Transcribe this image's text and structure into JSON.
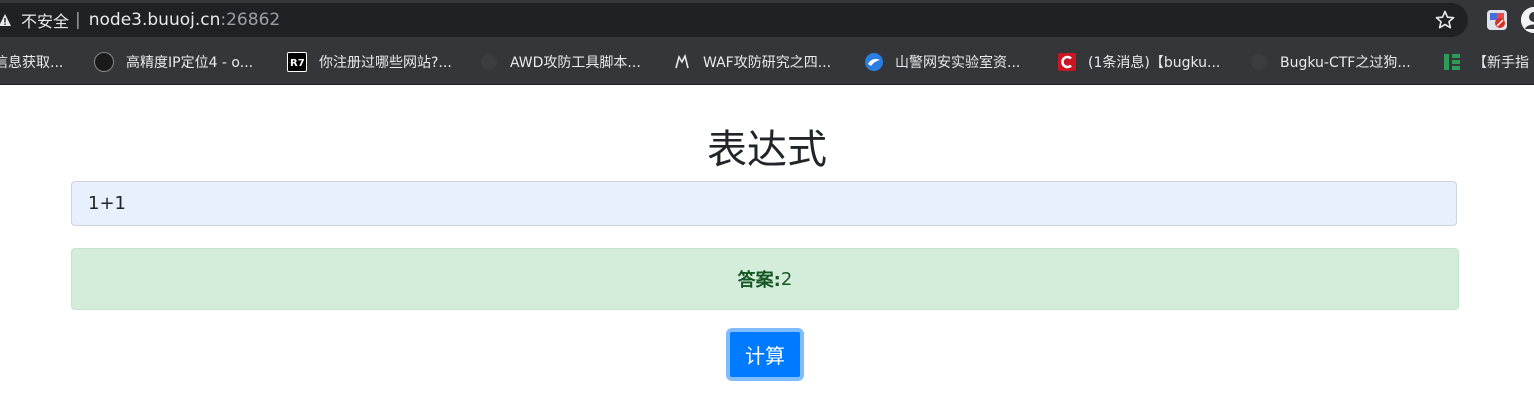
{
  "browser": {
    "security_label": "不安全",
    "separator": "|",
    "url_host": "node3.buuoj.cn",
    "url_port": ":26862",
    "bookmarks": [
      {
        "label": "信息获取...",
        "icon": "none"
      },
      {
        "label": "高精度IP定位4 - o...",
        "icon": "avatar-icon"
      },
      {
        "label": "你注册过哪些网站?...",
        "icon": "r7-icon"
      },
      {
        "label": "AWD攻防工具脚本...",
        "icon": "github-icon"
      },
      {
        "label": "WAF攻防研究之四...",
        "icon": "wolf-icon"
      },
      {
        "label": "山警网安实验室资...",
        "icon": "bird-icon"
      },
      {
        "label": "(1条消息)【bugku...",
        "icon": "csdn-icon"
      },
      {
        "label": "Bugku-CTF之过狗...",
        "icon": "github-icon"
      },
      {
        "label": "【新手指",
        "icon": "green-bars-icon"
      }
    ]
  },
  "page": {
    "title": "表达式",
    "expression_value": "1+1",
    "answer_label": "答案:",
    "answer_value": "2",
    "calc_button_label": "计算"
  },
  "colors": {
    "button_bg": "#007bff",
    "answer_bg": "#d4edda",
    "answer_text": "#155724",
    "input_bg": "#e8f0fe",
    "chrome_bg": "#35363a"
  }
}
